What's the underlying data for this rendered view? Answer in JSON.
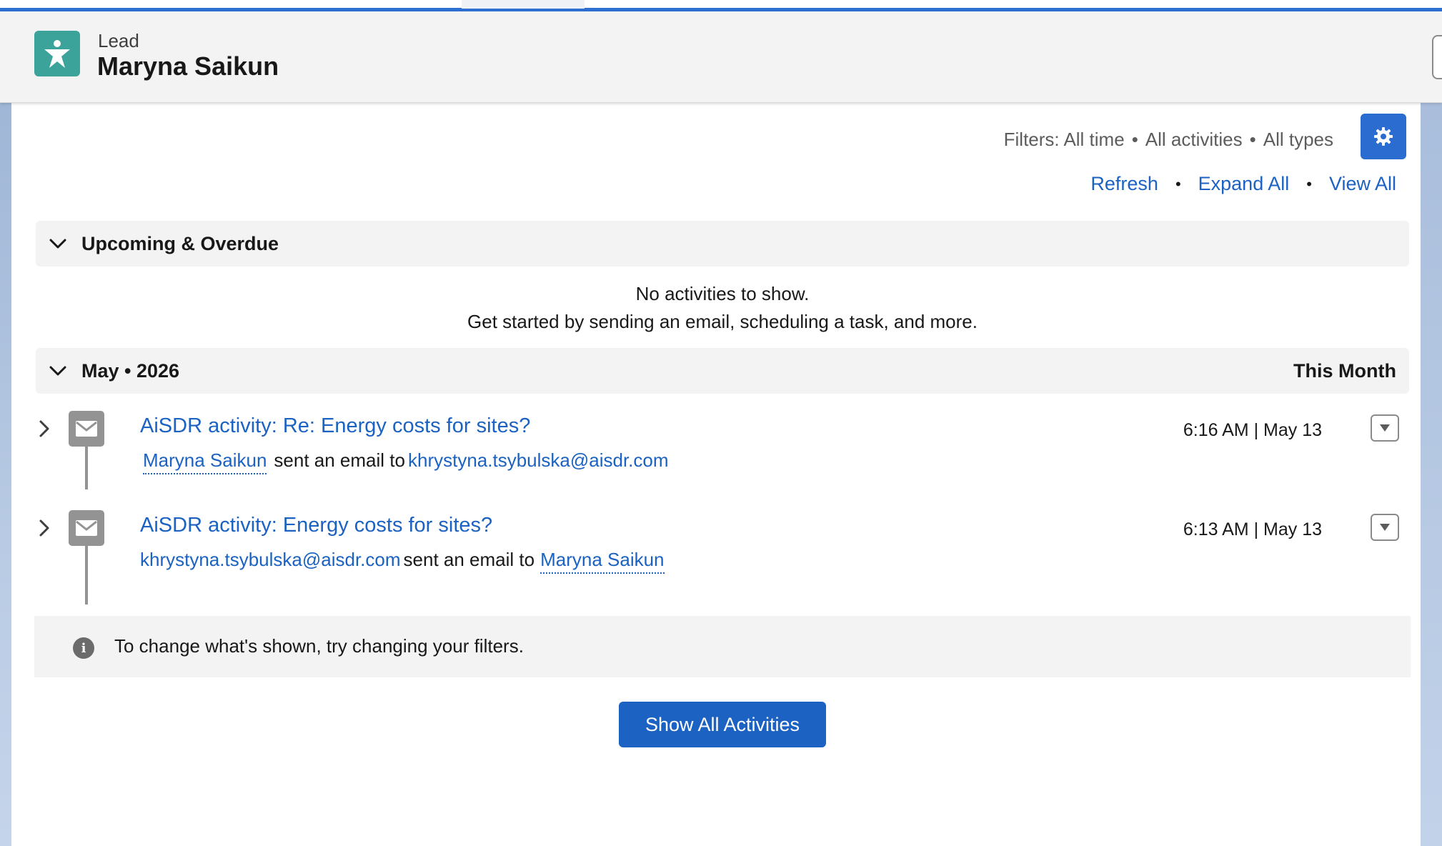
{
  "header": {
    "object_label": "Lead",
    "record_name": "Maryna Saikun",
    "icon": "lead-person-icon"
  },
  "filters": {
    "prefix": "Filters:",
    "time": "All time",
    "activities": "All activities",
    "types": "All types",
    "separator": "•",
    "settings_icon": "gear-icon"
  },
  "actions": {
    "refresh": "Refresh",
    "expand_all": "Expand All",
    "view_all": "View All",
    "separator": "•"
  },
  "upcoming": {
    "title": "Upcoming & Overdue",
    "empty_line1": "No activities to show.",
    "empty_line2": "Get started by sending an email, scheduling a task, and more."
  },
  "month_group": {
    "title": "May • 2026",
    "period": "This Month"
  },
  "activities": [
    {
      "title": "AiSDR activity: Re: Energy costs for sites?",
      "from": "Maryna Saikun",
      "verb": "sent an email to",
      "to": "khrystyna.tsybulska@aisdr.com",
      "time": "6:16 AM | May 13",
      "icon": "email-icon"
    },
    {
      "title": "AiSDR activity: Energy costs for sites?",
      "from": "khrystyna.tsybulska@aisdr.com",
      "verb": "sent an email to",
      "to": "Maryna Saikun",
      "time": "6:13 AM | May 13",
      "icon": "email-icon"
    }
  ],
  "info": {
    "text": "To change what's shown, try changing your filters.",
    "icon": "info-icon"
  },
  "show_all_button": "Show All Activities",
  "colors": {
    "brand_blue": "#1b62c2",
    "lead_icon_bg": "#3ba39a",
    "email_icon_bg": "#939393"
  }
}
